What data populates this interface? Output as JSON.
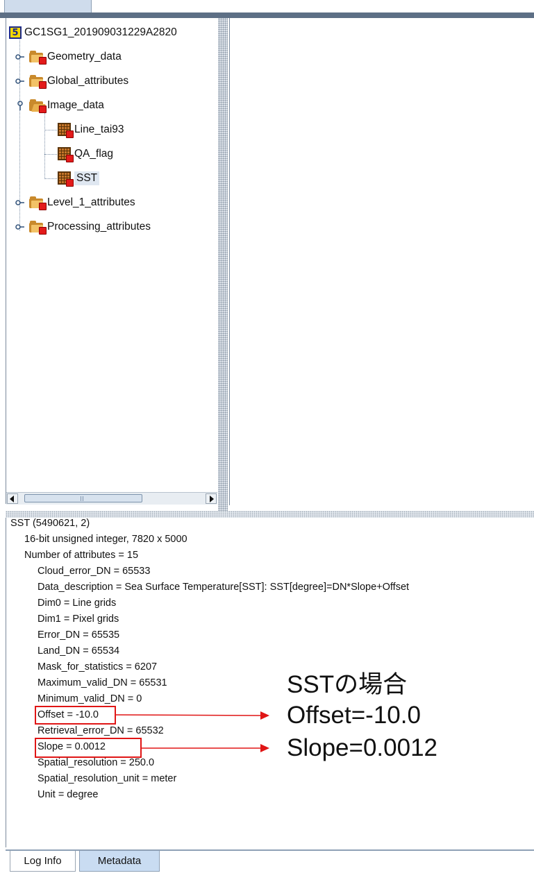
{
  "tree": {
    "root": {
      "label": "GC1SG1_201909031229A2820",
      "icon": "file-icon-s"
    },
    "nodes": [
      {
        "label": "Geometry_data",
        "icon": "folder-icon"
      },
      {
        "label": "Global_attributes",
        "icon": "folder-icon"
      },
      {
        "label": "Image_data",
        "icon": "folder-open-icon"
      },
      {
        "label": "Line_tai93",
        "icon": "dataset-grid-icon"
      },
      {
        "label": "QA_flag",
        "icon": "dataset-grid-icon"
      },
      {
        "label": "SST",
        "icon": "dataset-grid-icon",
        "selected": true
      },
      {
        "label": "Level_1_attributes",
        "icon": "folder-icon"
      },
      {
        "label": "Processing_attributes",
        "icon": "folder-icon"
      }
    ]
  },
  "metadata": {
    "header": "SST (5490621, 2)",
    "type_line": "16-bit unsigned integer,    7820 x 5000",
    "attr_count": "Number of attributes = 15",
    "attributes": [
      "Cloud_error_DN = 65533",
      "Data_description = Sea Surface Temperature[SST]: SST[degree]=DN*Slope+Offset",
      "Dim0 = Line grids",
      "Dim1 = Pixel grids",
      "Error_DN = 65535",
      "Land_DN = 65534",
      "Mask_for_statistics = 6207",
      "Maximum_valid_DN = 65531",
      "Minimum_valid_DN = 0",
      "Offset = -10.0",
      "Retrieval_error_DN = 65532",
      "Slope = 0.0012",
      "Spatial_resolution = 250.0",
      "Spatial_resolution_unit = meter",
      "Unit = degree"
    ]
  },
  "annotation": {
    "title": "SSTの場合",
    "offset": "Offset=-10.0",
    "slope": "Slope=0.0012",
    "color": "#e01515"
  },
  "tabs": {
    "log": "Log Info",
    "metadata": "Metadata",
    "active": "Metadata"
  },
  "scrollbar": {
    "thumb_glyph": "|||"
  }
}
